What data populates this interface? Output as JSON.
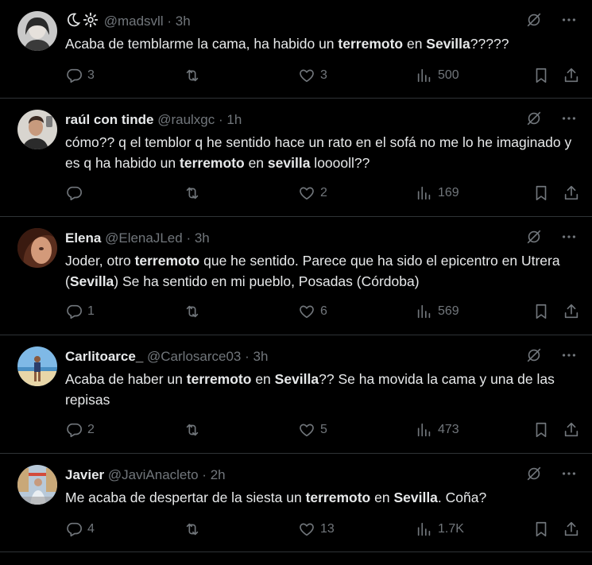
{
  "tweets": [
    {
      "display_name": "",
      "name_icons": [
        "crescent-moon-icon",
        "gear-icon"
      ],
      "handle": "@madsvll",
      "time": "3h",
      "text_segments": [
        {
          "t": "Acaba de temblarme la cama, ha habido un ",
          "b": false
        },
        {
          "t": "terremoto",
          "b": true
        },
        {
          "t": " en ",
          "b": false
        },
        {
          "t": "Sevilla",
          "b": true
        },
        {
          "t": "?????",
          "b": false
        }
      ],
      "replies": "3",
      "retweets": "",
      "likes": "3",
      "views": "500"
    },
    {
      "display_name": "raúl con tinde",
      "handle": "@raulxgc",
      "time": "1h",
      "text_segments": [
        {
          "t": "cómo?? q el temblor q he sentido hace un rato en el sofá no me lo he imaginado y es q ha habido un ",
          "b": false
        },
        {
          "t": "terremoto",
          "b": true
        },
        {
          "t": " en ",
          "b": false
        },
        {
          "t": "sevilla",
          "b": true
        },
        {
          "t": " looooll??",
          "b": false
        }
      ],
      "replies": "",
      "retweets": "",
      "likes": "2",
      "views": "169"
    },
    {
      "display_name": "Elena",
      "handle": "@ElenaJLed",
      "time": "3h",
      "text_segments": [
        {
          "t": "Joder, otro ",
          "b": false
        },
        {
          "t": "terremoto",
          "b": true
        },
        {
          "t": " que he sentido. Parece que ha sido el epicentro en Utrera (",
          "b": false
        },
        {
          "t": "Sevilla",
          "b": true
        },
        {
          "t": ") Se ha sentido en mi pueblo, Posadas (Córdoba)",
          "b": false
        }
      ],
      "replies": "1",
      "retweets": "",
      "likes": "6",
      "views": "569"
    },
    {
      "display_name": "Carlitoarce_",
      "handle": "@Carlosarce03",
      "time": "3h",
      "text_segments": [
        {
          "t": "Acaba de haber un ",
          "b": false
        },
        {
          "t": "terremoto",
          "b": true
        },
        {
          "t": " en ",
          "b": false
        },
        {
          "t": "Sevilla",
          "b": true
        },
        {
          "t": "?? Se ha movida la cama y una de las repisas",
          "b": false
        }
      ],
      "replies": "2",
      "retweets": "",
      "likes": "5",
      "views": "473"
    },
    {
      "display_name": "Javier",
      "handle": "@JaviAnacleto",
      "time": "2h",
      "text_segments": [
        {
          "t": "Me acaba de despertar de la siesta un ",
          "b": false
        },
        {
          "t": "terremoto",
          "b": true
        },
        {
          "t": " en ",
          "b": false
        },
        {
          "t": "Sevilla",
          "b": true
        },
        {
          "t": ". Coña?",
          "b": false
        }
      ],
      "replies": "4",
      "retweets": "",
      "likes": "13",
      "views": "1.7K"
    }
  ],
  "separator": "·",
  "colors": {
    "background": "#000000",
    "text": "#e7e9ea",
    "muted": "#71767b",
    "border": "#2f3336"
  }
}
